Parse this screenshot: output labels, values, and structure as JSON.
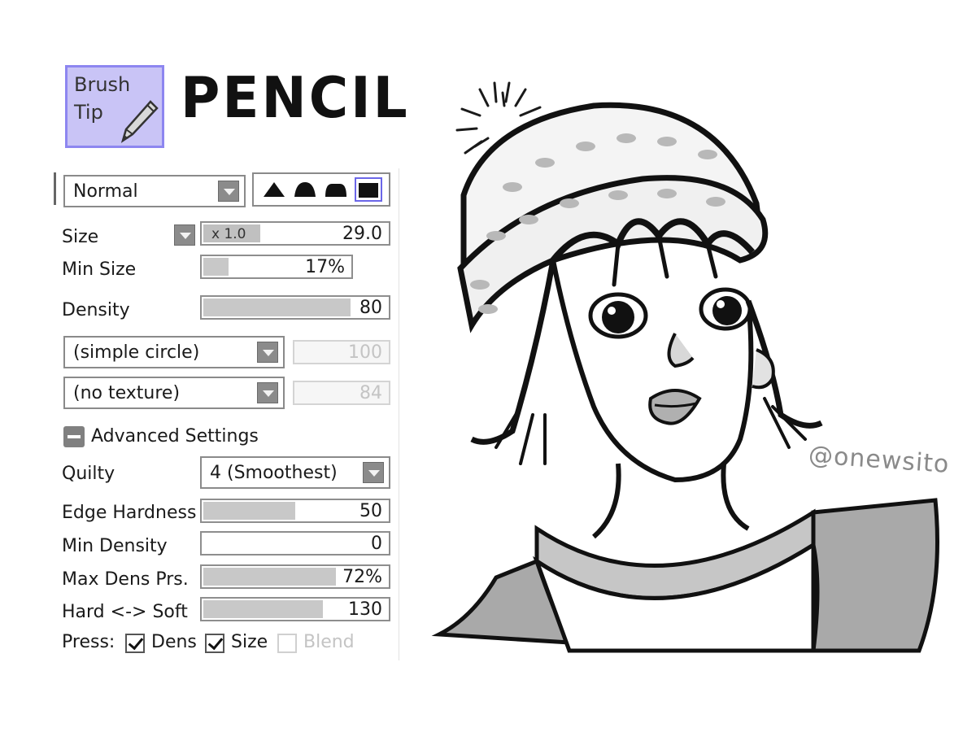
{
  "header": {
    "brush_tip_label": "Brush\nTip",
    "tool_title": "PENCIL"
  },
  "panel": {
    "blend_mode": "Normal",
    "size": {
      "label": "Size",
      "multiplier": "x 1.0",
      "value": "29.0"
    },
    "min_size": {
      "label": "Min Size",
      "value": "17%",
      "level": 0.17
    },
    "density": {
      "label": "Density",
      "value": "80",
      "level": 0.8
    },
    "shape": {
      "name": "(simple circle)",
      "value": "100"
    },
    "texture": {
      "name": "(no texture)",
      "value": "84"
    },
    "advanced": {
      "label": "Advanced Settings"
    },
    "quality": {
      "label": "Quilty",
      "value": "4 (Smoothest)"
    },
    "edge_hardness": {
      "label": "Edge Hardness",
      "value": "50",
      "level": 0.5
    },
    "min_density": {
      "label": "Min Density",
      "value": "0",
      "level": 0
    },
    "max_dens_prs": {
      "label": "Max Dens Prs.",
      "value": "72%",
      "level": 0.72
    },
    "hard_soft": {
      "label": "Hard <-> Soft",
      "value": "130",
      "level": 0.65
    },
    "press": {
      "label": "Press:",
      "dens": "Dens",
      "size": "Size",
      "blend": "Blend",
      "dens_checked": true,
      "size_checked": true,
      "blend_checked": false
    }
  },
  "watermark": "@onewsito",
  "colors": {
    "accent": "#8d86f0",
    "brush_tip_bg": "#c9c4f6",
    "fill": "#c8c8c8"
  },
  "icons": [
    "pencil-icon",
    "chevron-down-icon",
    "minus-icon",
    "check-icon"
  ]
}
